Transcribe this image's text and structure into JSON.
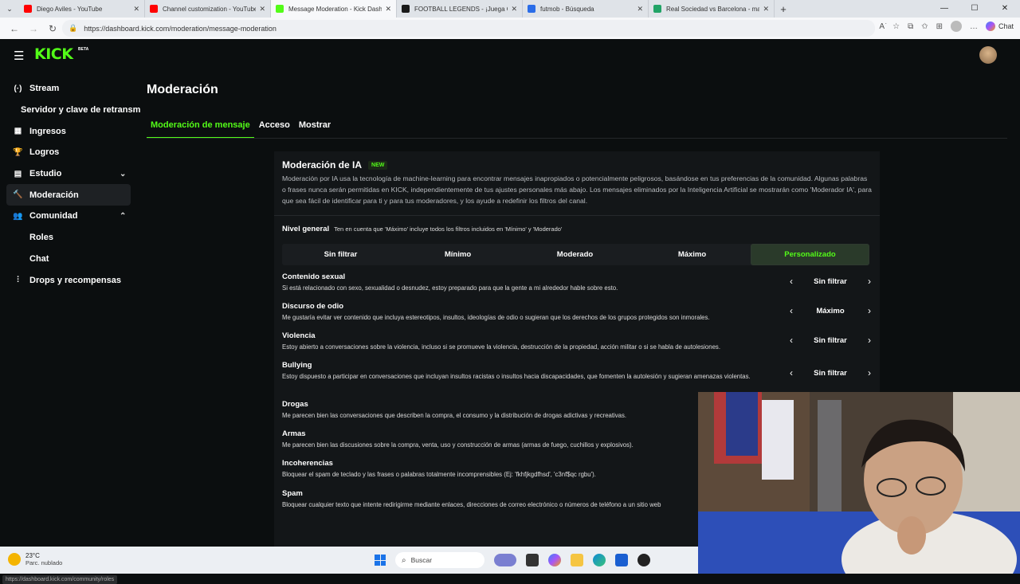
{
  "browser": {
    "tabs": [
      {
        "title": "Diego Aviles - YouTube",
        "color": "#ff0000",
        "active": false
      },
      {
        "title": "Channel customization - YouTube",
        "color": "#ff0000",
        "active": false
      },
      {
        "title": "Message Moderation - Kick Dash",
        "color": "#53fc18",
        "active": true
      },
      {
        "title": "FOOTBALL LEGENDS - ¡Juega Gra",
        "color": "#1a1a1a",
        "active": false
      },
      {
        "title": "futmob - Búsqueda",
        "color": "#2b6de8",
        "active": false
      },
      {
        "title": "Real Sociedad vs Barcelona - mar",
        "color": "#21a366",
        "active": false
      }
    ],
    "url": "https://dashboard.kick.com/moderation/message-moderation",
    "chat_label": "Chat"
  },
  "app": {
    "logo": "KICK",
    "logo_badge": "BETA"
  },
  "sidebar": {
    "items": [
      {
        "label": "Stream",
        "icon": "(·)"
      },
      {
        "label": "Servidor y clave de retransmisión",
        "icon": ""
      },
      {
        "label": "Ingresos",
        "icon": "▦"
      },
      {
        "label": "Logros",
        "icon": "🏆"
      },
      {
        "label": "Estudio",
        "icon": "▤",
        "chev": "⌄"
      },
      {
        "label": "Moderación",
        "icon": "🔨"
      },
      {
        "label": "Comunidad",
        "icon": "👥",
        "chev": "⌃"
      },
      {
        "label": "Roles",
        "icon": ""
      },
      {
        "label": "Chat",
        "icon": ""
      },
      {
        "label": "Drops y recompensas",
        "icon": "⫶"
      }
    ]
  },
  "main": {
    "title": "Moderación",
    "tabs": [
      "Moderación de mensaje",
      "Acceso",
      "Mostrar"
    ]
  },
  "card": {
    "title": "Moderación de IA",
    "badge": "NEW",
    "description": "Moderación por IA usa la tecnología de machine-learning para encontrar mensajes inapropiados o potencialmente peligrosos, basándose en tus preferencias de la comunidad. Algunas palabras o frases nunca serán permitidas en KICK, independientemente de tus ajustes personales más abajo. Los mensajes eliminados por la Inteligencia Artificial se mostrarán como 'Moderador IA', para que sea fácil de identificar para ti y para tus moderadores, y los ayude a redefinir los filtros del canal.",
    "level_label": "Nivel general",
    "level_hint": "Ten en cuenta que 'Máximo' incluye todos los filtros incluidos en 'Mínimo' y 'Moderado'",
    "levels": [
      "Sin filtrar",
      "Mínimo",
      "Moderado",
      "Máximo",
      "Personalizado"
    ],
    "selected_level": "Personalizado",
    "categories": [
      {
        "name": "Contenido sexual",
        "desc": "Si está relacionado con sexo, sexualidad o desnudez, estoy preparado para que la gente a mi alrededor hable sobre esto.",
        "value": "Sin filtrar"
      },
      {
        "name": "Discurso de odio",
        "desc": "Me gustaría evitar ver contenido que incluya estereotipos, insultos, ideologías de odio o sugieran que los derechos de los grupos protegidos son inmorales.",
        "value": "Máximo"
      },
      {
        "name": "Violencia",
        "desc": "Estoy abierto a conversaciones sobre la violencia, incluso si se promueve la violencia, destrucción de la propiedad, acción militar o si se habla de autolesiones.",
        "value": "Sin filtrar"
      },
      {
        "name": "Bullying",
        "desc": "Estoy dispuesto a participar en conversaciones que incluyan insultos racistas o insultos hacia discapacidades, que fomenten la autolesión y sugieran amenazas violentas.",
        "value": "Sin filtrar"
      },
      {
        "name": "Drogas",
        "desc": "Me parecen bien las conversaciones que describen la compra, el consumo y la distribución de drogas adictivas y recreativas.",
        "value": ""
      },
      {
        "name": "Armas",
        "desc": "Me parecen bien las discusiones sobre la compra, venta, uso y construcción de armas (armas de fuego, cuchillos y explosivos).",
        "value": ""
      },
      {
        "name": "Incoherencias",
        "desc": "Bloquear el spam de teclado y las frases o palabras totalmente incomprensibles (Ej: 'fkhfjkgdfhsd', 'c3nf$qc rgbu').",
        "value": ""
      },
      {
        "name": "Spam",
        "desc": "Bloquear cualquier texto que intente redirigirme mediante enlaces, direcciones de correo electrónico o números de teléfono a un sitio web",
        "value": ""
      }
    ]
  },
  "status_url": "https://dashboard.kick.com/community/roles",
  "taskbar": {
    "temp": "23°C",
    "weather": "Parc. nublado",
    "search": "Buscar"
  }
}
